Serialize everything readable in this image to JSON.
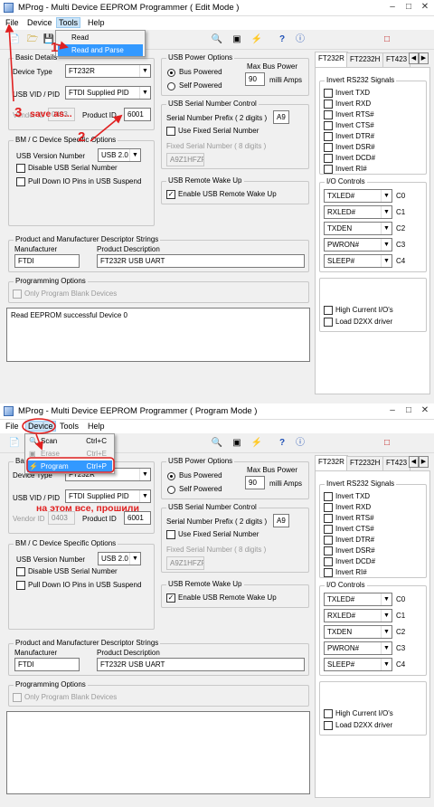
{
  "top": {
    "title": "MProg - Multi Device EEPROM Programmer ( Edit Mode )",
    "menus": [
      "File",
      "Device",
      "Tools",
      "Help"
    ],
    "tools_menu": [
      "Read",
      "Read and Parse"
    ],
    "status": "Read EEPROM successful Device 0"
  },
  "bottom": {
    "title": "MProg - Multi Device EEPROM Programmer ( Program Mode )",
    "menus": [
      "File",
      "Device",
      "Tools",
      "Help"
    ],
    "device_menu": [
      {
        "label": "Scan",
        "shortcut": "Ctrl+C"
      },
      {
        "label": "Erase",
        "shortcut": "Ctrl+E"
      },
      {
        "label": "Program",
        "shortcut": "Ctrl+P"
      }
    ],
    "status": ""
  },
  "form": {
    "basic": {
      "title": "Basic Details",
      "device_type_label": "Device Type",
      "device_type": "FT232R",
      "vid_pid_label": "USB VID / PID",
      "vid_pid": "FTDI Supplied PID",
      "vendor_id_label": "Vendor ID",
      "vendor_id": "0403",
      "product_id_label": "Product ID",
      "product_id": "6001"
    },
    "bmc": {
      "title": "BM / C Device Specific Options",
      "usb_version_label": "USB Version Number",
      "usb_version": "USB 2.0",
      "disable_serial": "Disable USB Serial Number",
      "pulldown": "Pull Down IO Pins in USB Suspend"
    },
    "power": {
      "title": "USB Power Options",
      "bus_powered": "Bus Powered",
      "self_powered": "Self Powered",
      "max_power_label": "Max Bus Power",
      "max_power": "90",
      "milli_amps": "milli Amps"
    },
    "serial": {
      "title": "USB Serial Number Control",
      "prefix_label": "Serial Number Prefix ( 2 digits )",
      "prefix": "A9",
      "use_fixed": "Use Fixed Serial Number",
      "fixed_label": "Fixed Serial Number ( 8 digits )",
      "fixed": "A9Z1HFZF"
    },
    "wake": {
      "title": "USB Remote Wake Up",
      "enable": "Enable USB Remote Wake Up"
    },
    "strings": {
      "title": "Product and Manufacturer Descriptor Strings",
      "manufacturer_label": "Manufacturer",
      "manufacturer": "FTDI",
      "product_label": "Product Description",
      "product": "FT232R USB UART"
    },
    "programming": {
      "title": "Programming Options",
      "only_blank": "Only Program Blank Devices"
    },
    "tabs": [
      "FT232R",
      "FT2232H",
      "FT423"
    ],
    "invert": {
      "title": "Invert RS232 Signals",
      "items": [
        "Invert TXD",
        "Invert RXD",
        "Invert RTS#",
        "Invert CTS#",
        "Invert DTR#",
        "Invert DSR#",
        "Invert DCD#",
        "Invert RI#"
      ]
    },
    "io": {
      "title": "I/O Controls",
      "items": [
        {
          "value": "TXLED#",
          "label": "C0"
        },
        {
          "value": "RXLED#",
          "label": "C1"
        },
        {
          "value": "TXDEN",
          "label": "C2"
        },
        {
          "value": "PWRON#",
          "label": "C3"
        },
        {
          "value": "SLEEP#",
          "label": "C4"
        }
      ]
    },
    "high_current": "High Current I/O's",
    "load_d2xx": "Load D2XX driver"
  },
  "annotations": {
    "n1": "1",
    "n2": "2",
    "n3": "3",
    "save_as": "save as...",
    "done_text": "на этом все, прошили"
  },
  "colors": {
    "accent": "#3399ff",
    "annotation": "#e02020"
  }
}
